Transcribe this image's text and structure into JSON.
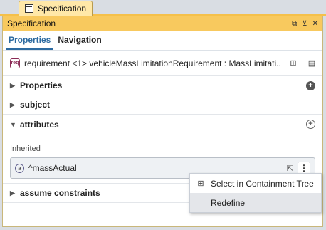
{
  "window_tab": {
    "label": "Specification"
  },
  "titlebar": {
    "title": "Specification"
  },
  "panel_tabs": [
    {
      "label": "Properties"
    },
    {
      "label": "Navigation"
    }
  ],
  "element": {
    "text": "requirement <1> vehicleMassLimitationRequirement : MassLimitati..."
  },
  "sections": {
    "properties": "Properties",
    "subject": "subject",
    "attributes": "attributes",
    "assume_constraints": "assume constraints"
  },
  "attributes": {
    "inherited_label": "Inherited",
    "field_value": "^massActual",
    "icon_letter": "a"
  },
  "context_menu": {
    "items": [
      {
        "label": "Select in Containment Tree"
      },
      {
        "label": "Redefine"
      }
    ]
  },
  "icons": {
    "req_icon": "req",
    "kebab": "⋮",
    "plus": "+"
  }
}
